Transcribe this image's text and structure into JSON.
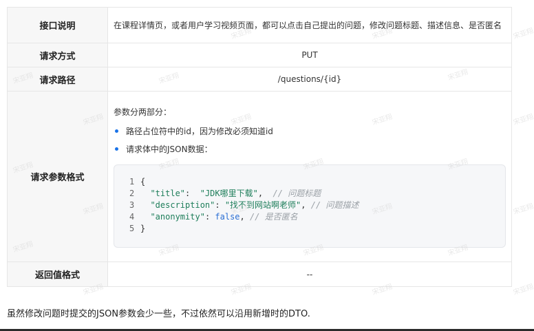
{
  "table": {
    "rows": {
      "desc": {
        "label": "接口说明",
        "value": "在课程详情页，或者用户学习视频页面，都可以点击自己提出的问题，修改问题标题、描述信息、是否匿名"
      },
      "method": {
        "label": "请求方式",
        "value": "PUT"
      },
      "path": {
        "label": "请求路径",
        "value": "/questions/{id}"
      },
      "params": {
        "label": "请求参数格式",
        "intro": "参数分两部分：",
        "bullets": [
          "路径占位符中的id，因为修改必须知道id",
          "请求体中的JSON数据："
        ],
        "code": {
          "line_numbers": [
            "1",
            "2",
            "3",
            "4",
            "5"
          ],
          "open_brace": "{",
          "close_brace": "}",
          "lines": [
            {
              "key": "\"title\"",
              "sep": ":  ",
              "value": "\"JDK哪里下载\"",
              "trail": ",  ",
              "comment": "// 问题标题"
            },
            {
              "key": "\"description\"",
              "sep": ": ",
              "value": "\"找不到网站啊老师\"",
              "trail": ", ",
              "comment": "// 问题描述"
            },
            {
              "key": "\"anonymity\"",
              "sep": ": ",
              "value": "false",
              "trail": ", ",
              "comment": "// 是否匿名"
            }
          ]
        }
      },
      "return": {
        "label": "返回值格式",
        "value": "--"
      }
    }
  },
  "footnote": "虽然修改问题时提交的JSON参数会少一些，不过依然可以沿用新增时的DTO.",
  "watermark": "宋亚翔"
}
